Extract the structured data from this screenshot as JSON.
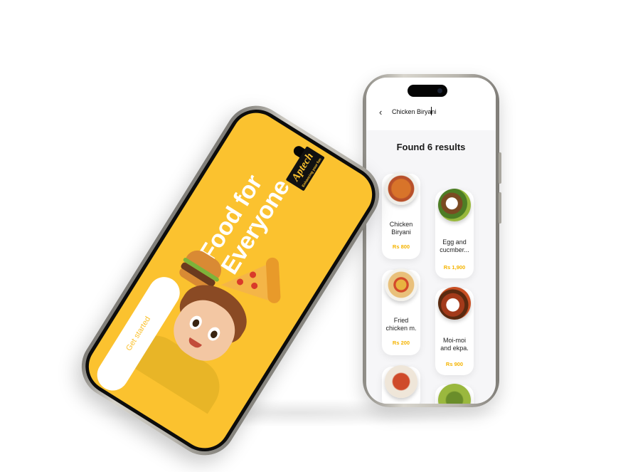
{
  "splash": {
    "logo_text": "Aptech",
    "logo_tagline": "Enhancing your fun",
    "headline_line1": "Food for",
    "headline_line2": "Everyone",
    "cta_label": "Get started"
  },
  "search": {
    "back_icon": "chevron-left-icon",
    "query": "Chicken Biryani",
    "found_prefix": "Found",
    "found_count": "6 results"
  },
  "results": [
    {
      "name_line1": "Chicken",
      "name_line2": "Biryani",
      "price": "Rs 800"
    },
    {
      "name_line1": "Egg and",
      "name_line2": "cucmber...",
      "price": "Rs 1,900"
    },
    {
      "name_line1": "Fried",
      "name_line2": "chicken m.",
      "price": "Rs 200"
    },
    {
      "name_line1": "Moi-moi",
      "name_line2": "and ekpa.",
      "price": "Rs 900"
    }
  ],
  "colors": {
    "brand_yellow": "#fbc22f",
    "price_accent": "#f5b400",
    "screen_bg": "#f6f6f8"
  }
}
